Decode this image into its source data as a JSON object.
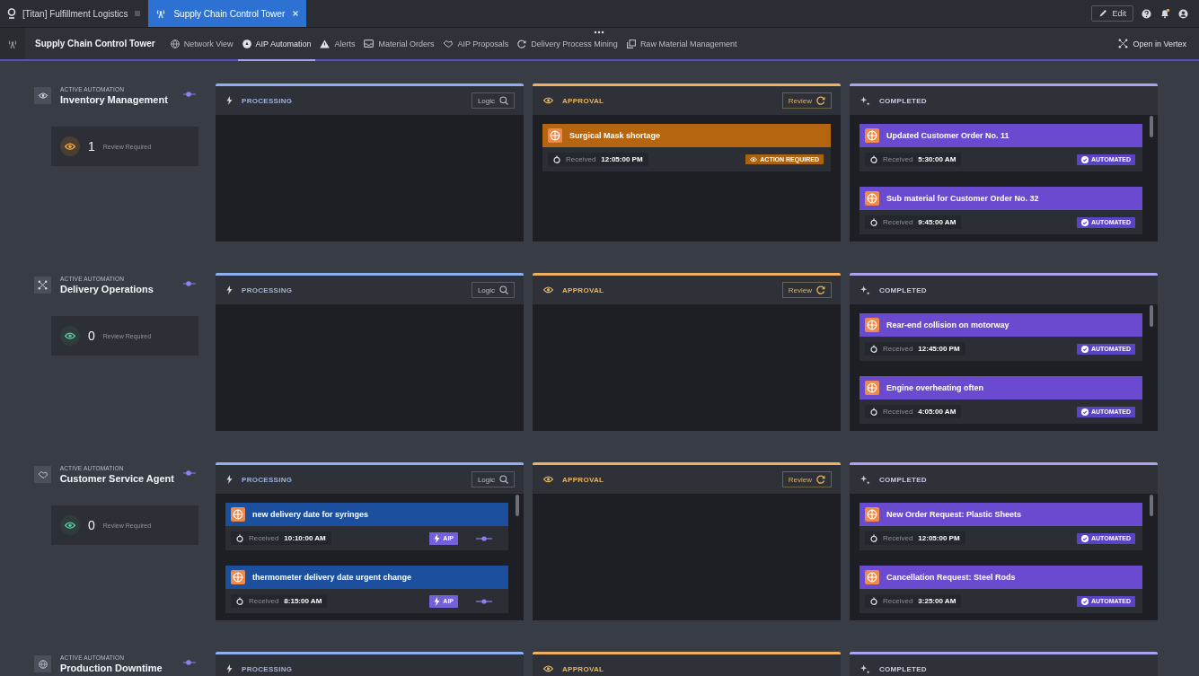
{
  "tabs": [
    {
      "label": "[Titan] Fulfillment Logistics",
      "selected": false
    },
    {
      "label": "Supply Chain Control Tower",
      "selected": true
    }
  ],
  "edit_button": "Edit",
  "nav": {
    "title": "Supply Chain Control Tower",
    "items": [
      {
        "label": "Network View",
        "selected": false
      },
      {
        "label": "AIP Automation",
        "selected": true
      },
      {
        "label": "Alerts",
        "selected": false
      },
      {
        "label": "Material Orders",
        "selected": false
      },
      {
        "label": "AIP Proposals",
        "selected": false
      },
      {
        "label": "Delivery Process Mining",
        "selected": false
      },
      {
        "label": "Raw Material Management",
        "selected": false
      }
    ],
    "open_in_vertex": "Open in Vertex"
  },
  "automations": [
    {
      "eyebrow": "ACTIVE AUTOMATION",
      "name": "Inventory Management",
      "review": {
        "count": "1",
        "label": "Review Required",
        "pending": true
      },
      "columns": [
        {
          "kind": "processing",
          "title": "PROCESSING",
          "button": "Logic"
        },
        {
          "kind": "approval",
          "title": "APPROVAL",
          "button": "Review",
          "cards": [
            {
              "title": "Surgical Mask shortage",
              "received_label": "Received",
              "time": "12:05:00 PM",
              "badge": "ACTION REQUIRED"
            }
          ]
        },
        {
          "kind": "completed",
          "title": "COMPLETED",
          "cards": [
            {
              "title": "Updated Customer Order No. 11",
              "received_label": "Received",
              "time": "5:30:00 AM",
              "badge": "AUTOMATED"
            },
            {
              "title": "Sub material for Customer Order No. 32",
              "received_label": "Received",
              "time": "9:45:00 AM",
              "badge": "AUTOMATED"
            }
          ]
        }
      ]
    },
    {
      "eyebrow": "ACTIVE AUTOMATION",
      "name": "Delivery Operations",
      "review": {
        "count": "0",
        "label": "Review Required",
        "pending": false
      },
      "columns": [
        {
          "kind": "processing",
          "title": "PROCESSING",
          "button": "Logic"
        },
        {
          "kind": "approval",
          "title": "APPROVAL",
          "button": "Review"
        },
        {
          "kind": "completed",
          "title": "COMPLETED",
          "cards": [
            {
              "title": "Rear-end collision on motorway",
              "received_label": "Received",
              "time": "12:45:00 PM",
              "badge": "AUTOMATED"
            },
            {
              "title": "Engine overheating often",
              "received_label": "Received",
              "time": "4:05:00 AM",
              "badge": "AUTOMATED"
            }
          ]
        }
      ]
    },
    {
      "eyebrow": "ACTIVE AUTOMATION",
      "name": "Customer Service Agent",
      "review": {
        "count": "0",
        "label": "Review Required",
        "pending": false
      },
      "columns": [
        {
          "kind": "processing",
          "title": "PROCESSING",
          "button": "Logic",
          "cards": [
            {
              "title": "new delivery date for syringes",
              "received_label": "Received",
              "time": "10:10:00 AM",
              "badge": "AIP"
            },
            {
              "title": "thermometer delivery date urgent change",
              "received_label": "Received",
              "time": "8:15:00 AM",
              "badge": "AIP"
            }
          ]
        },
        {
          "kind": "approval",
          "title": "APPROVAL",
          "button": "Review"
        },
        {
          "kind": "completed",
          "title": "COMPLETED",
          "cards": [
            {
              "title": "New Order Request: Plastic Sheets",
              "received_label": "Received",
              "time": "12:05:00 PM",
              "badge": "AUTOMATED"
            },
            {
              "title": "Cancellation Request: Steel Rods",
              "received_label": "Received",
              "time": "3:25:00 AM",
              "badge": "AUTOMATED"
            }
          ]
        }
      ]
    },
    {
      "eyebrow": "ACTIVE AUTOMATION",
      "name": "Production Downtime",
      "columns": [
        {
          "kind": "processing",
          "title": "PROCESSING"
        },
        {
          "kind": "approval",
          "title": "APPROVAL"
        },
        {
          "kind": "completed",
          "title": "COMPLETED"
        }
      ]
    }
  ]
}
